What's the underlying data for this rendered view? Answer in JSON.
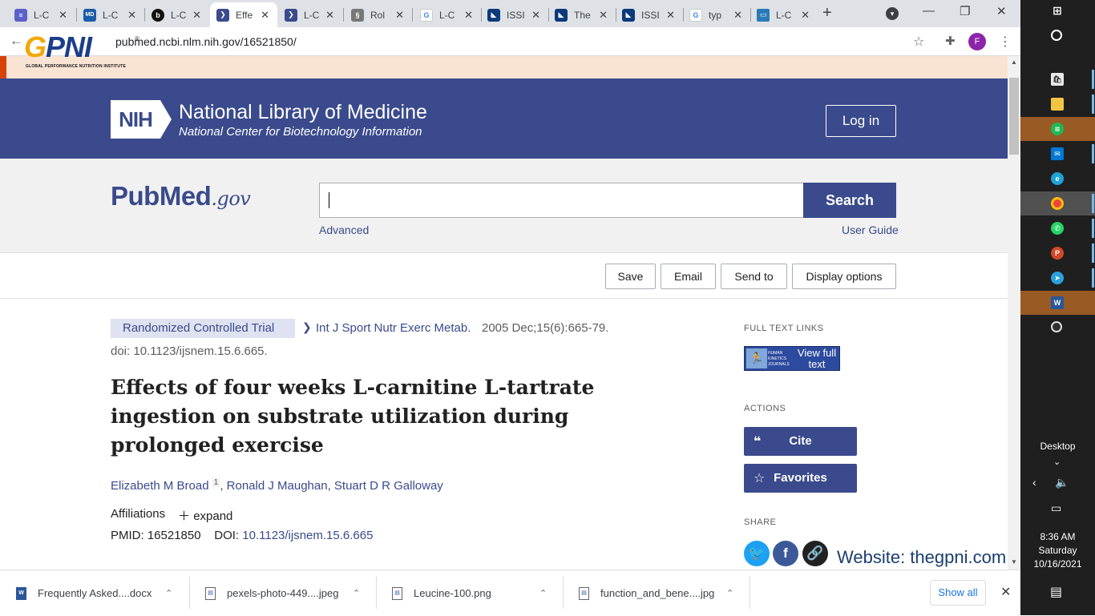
{
  "browser": {
    "tabs": [
      {
        "title": "L-C",
        "icon": "doc-icon",
        "color": "#5b5fc7"
      },
      {
        "title": "L-C",
        "icon": "webmd-icon",
        "color": "#1b5da8"
      },
      {
        "title": "L-C",
        "icon": "bold-b-icon",
        "color": "#111111"
      },
      {
        "title": "Effe",
        "icon": "pubmed-icon",
        "color": "#3a4a8c",
        "active": true
      },
      {
        "title": "L-C",
        "icon": "pubmed-icon",
        "color": "#3a4a8c"
      },
      {
        "title": "Rol",
        "icon": "dna-icon",
        "color": "#555555"
      },
      {
        "title": "L-C",
        "icon": "google-icon",
        "color": "#4285f4"
      },
      {
        "title": "ISSI",
        "icon": "issn-icon",
        "color": "#0a3a7a"
      },
      {
        "title": "The",
        "icon": "issn-icon",
        "color": "#0a3a7a"
      },
      {
        "title": "ISSI",
        "icon": "issn-icon",
        "color": "#0a3a7a"
      },
      {
        "title": "typ",
        "icon": "google-icon",
        "color": "#4285f4"
      },
      {
        "title": "L-C",
        "icon": "card-icon",
        "color": "#2a7ab8"
      }
    ],
    "url": "pubmed.ncbi.nlm.nih.gov/16521850/",
    "profile_initial": "F"
  },
  "overlay": {
    "logo_text_a": "G",
    "logo_text_b": "PNI",
    "logo_sub": "GLOBAL PERFORMANCE NUTRITION INSTITUTE",
    "reg": "®",
    "website": "Website: thegpni.com"
  },
  "header": {
    "nih": "NIH",
    "title": "National Library of Medicine",
    "subtitle": "National Center for Biotechnology Information",
    "login": "Log in"
  },
  "search": {
    "logo_a": "Pub",
    "logo_b": "Med",
    "logo_c": ".gov",
    "button": "Search",
    "advanced": "Advanced",
    "user_guide": "User Guide"
  },
  "actions": {
    "save": "Save",
    "email": "Email",
    "send_to": "Send to",
    "display_options": "Display options"
  },
  "article": {
    "pub_type": "Randomized Controlled Trial",
    "journal": "Int J Sport Nutr Exerc Metab.",
    "date": "2005 Dec;15(6):665-79.",
    "doi_line": "doi: 10.1123/ijsnem.15.6.665.",
    "title": "Effects of four weeks L-carnitine L-tartrate ingestion on substrate utilization during prolonged exercise",
    "authors": [
      "Elizabeth M Broad",
      "Ronald J Maughan",
      "Stuart D R Galloway"
    ],
    "author_sup": "1",
    "affiliations": "Affiliations",
    "expand": "expand",
    "pmid_label": "PMID: 16521850",
    "doi_label": "DOI:",
    "doi_link": "10.1123/ijsnem.15.6.665"
  },
  "sidebar": {
    "full_text_links": "FULL TEXT LINKS",
    "hk_text": "HUMAN KINETICS JOURNALS",
    "view_full_text": "View full text",
    "actions": "ACTIONS",
    "cite": "Cite",
    "favorites": "Favorites",
    "share": "SHARE"
  },
  "downloads": [
    {
      "name": "Frequently Asked....docx",
      "icon": "word-icon"
    },
    {
      "name": "pexels-photo-449....jpeg",
      "icon": "image-icon"
    },
    {
      "name": "Leucine-100.png",
      "icon": "image-icon"
    },
    {
      "name": "function_and_bene....jpg",
      "icon": "image-icon"
    }
  ],
  "download_bar": {
    "show_all": "Show all"
  },
  "taskbar": {
    "desktop": "Desktop",
    "time": "8:36 AM",
    "day": "Saturday",
    "date": "10/16/2021"
  },
  "colors": {
    "pubmed_blue": "#3a4a8c",
    "banner": "#f9e4d4",
    "banner_accent": "#d54309"
  }
}
